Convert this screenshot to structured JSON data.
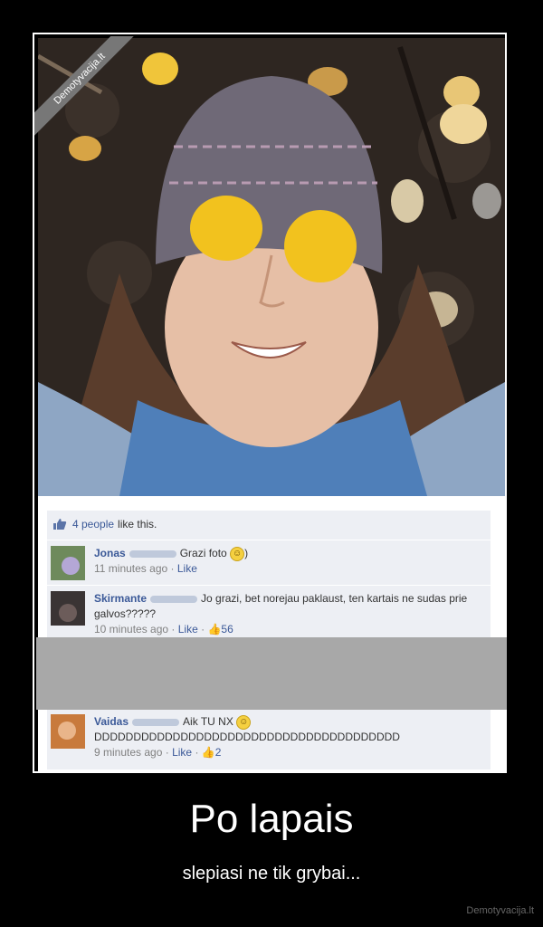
{
  "watermark": "Demotyvacija.lt",
  "likes": {
    "count_text": "4 people",
    "suffix": "like this."
  },
  "comments": [
    {
      "name": "Jonas",
      "text": "Grazi foto",
      "emoji": "smile-icon",
      "emoji_after": ")",
      "time": "11 minutes ago",
      "like": "Like",
      "like_count": ""
    },
    {
      "name": "Skirmante",
      "text": "Jo grazi, bet norejau paklaust, ten kartais ne sudas prie galvos?????",
      "time": "10 minutes ago",
      "like": "Like",
      "like_count": "56"
    },
    {
      "name": "Vaidas",
      "text": "Aik TU NX",
      "text2": "DDDDDDDDDDDDDDDDDDDDDDDDDDDDDDDDDDDDDDD",
      "time": "9 minutes ago",
      "like": "Like",
      "like_count": "2"
    }
  ],
  "separator": "·",
  "caption": {
    "title": "Po lapais",
    "subtitle": "slepiasi ne tik grybai..."
  },
  "footer": "Demotyvacija.lt",
  "colors": {
    "link": "#3b5998",
    "panel": "#edeff4",
    "leaf": "#f2c21e",
    "hat": "#6f6977",
    "scarf": "#4f7fb9"
  }
}
